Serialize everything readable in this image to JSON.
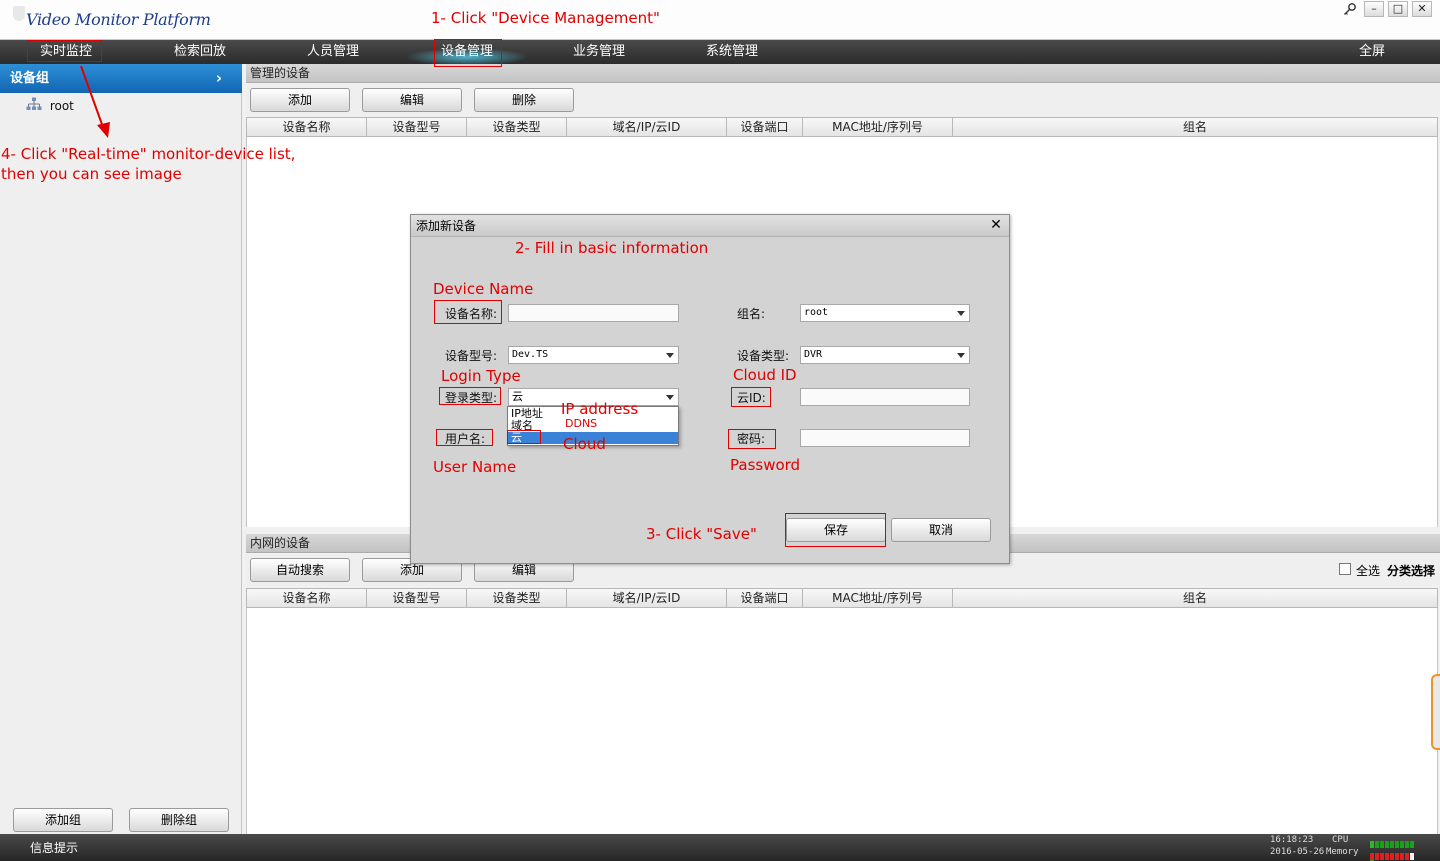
{
  "app": {
    "title": "Video Monitor Platform"
  },
  "window_controls": [
    "–",
    "□",
    "✕"
  ],
  "menu": {
    "items": [
      "实时监控",
      "检索回放",
      "人员管理",
      "设备管理",
      "业务管理",
      "系统管理"
    ],
    "fullscreen": "全屏"
  },
  "sidebar": {
    "header": "设备组",
    "tree_root": "root",
    "add_group": "添加组",
    "delete_group": "删除组"
  },
  "managed": {
    "title": "管理的设备",
    "buttons": [
      "添加",
      "编辑",
      "删除"
    ],
    "columns": [
      "设备名称",
      "设备型号",
      "设备类型",
      "域名/IP/云ID",
      "设备端口",
      "MAC地址/序列号",
      "组名"
    ]
  },
  "lan": {
    "title": "内网的设备",
    "buttons": [
      "自动搜索",
      "添加",
      "编辑"
    ],
    "select_all": "全选",
    "filter": "分类选择",
    "columns": [
      "设备名称",
      "设备型号",
      "设备类型",
      "域名/IP/云ID",
      "设备端口",
      "MAC地址/序列号",
      "组名"
    ]
  },
  "dialog": {
    "title": "添加新设备",
    "device_name_label": "设备名称:",
    "device_name_value": "",
    "group_label": "组名:",
    "group_value": "root",
    "model_label": "设备型号:",
    "model_value": "Dev.TS",
    "type_label": "设备类型:",
    "type_value": "DVR",
    "login_label": "登录类型:",
    "login_value": "云",
    "cloud_id_label": "云ID:",
    "cloud_id_value": "",
    "user_label": "用户名:",
    "password_label": "密码:",
    "save": "保存",
    "cancel": "取消",
    "login_options": [
      "IP地址",
      "域名",
      "云"
    ]
  },
  "annotations": {
    "step1": "1- Click \"Device Management\"",
    "step2": "2- Fill in basic information",
    "step3": "3- Click \"Save\"",
    "step4_line1": "4- Click \"Real-time\" monitor-device list,",
    "step4_line2": "then you can see image",
    "device_name": "Device Name",
    "login_type": "Login Type",
    "cloud_id": "Cloud ID",
    "ip_address": "IP address",
    "ddns": "DDNS",
    "cloud": "Cloud",
    "user_name": "User Name",
    "password": "Password"
  },
  "status": {
    "text": "信息提示",
    "time": "16:18:23",
    "date": "2016-05-26",
    "cpu_label": "CPU",
    "memory_label": "Memory",
    "cpu_load": 0.1,
    "memory_load": 0.75
  },
  "colors": {
    "annotation": "#e00000",
    "accent_blue": "#1266b3",
    "menu_bg": "#2b2b2b"
  }
}
